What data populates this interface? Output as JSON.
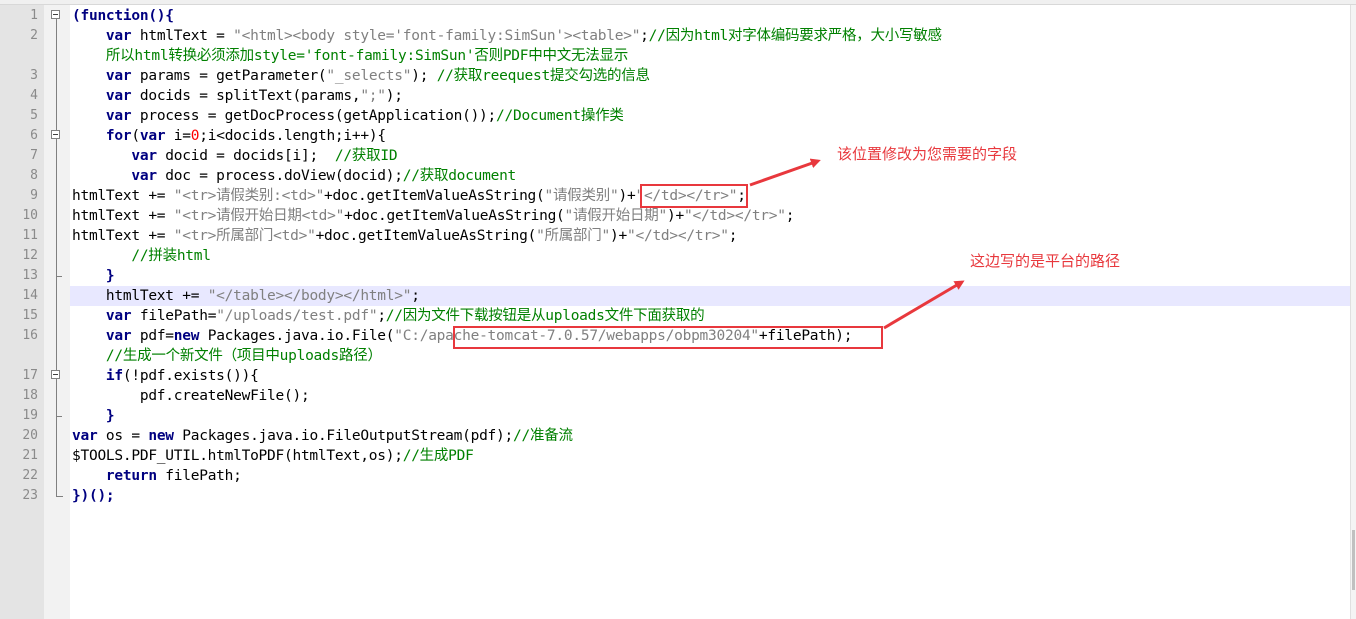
{
  "editor": {
    "lines": [
      {
        "n": "1",
        "fold": "start",
        "tokens": [
          [
            "kw",
            "(function(){"
          ]
        ]
      },
      {
        "n": "2",
        "fold": "body",
        "tokens": [
          [
            "pl",
            "    "
          ],
          [
            "kw",
            "var"
          ],
          [
            "pl",
            " htmlText = "
          ],
          [
            "str",
            "\"<html><body style='font-family:SimSun'><table>\""
          ],
          [
            "pl",
            ";"
          ],
          [
            "cm",
            "//因为html对字体编码要求严格，大小写敏感"
          ]
        ],
        "wrap": [
          [
            "pl",
            "    "
          ],
          [
            "cm",
            "所以html转换必须添加style='font-family:SimSun'否则PDF中中文无法显示"
          ]
        ]
      },
      {
        "n": "3",
        "fold": "body",
        "tokens": [
          [
            "pl",
            "    "
          ],
          [
            "kw",
            "var"
          ],
          [
            "pl",
            " params = getParameter("
          ],
          [
            "str",
            "\"_selects\""
          ],
          [
            "pl",
            "); "
          ],
          [
            "cm",
            "//获取reequest提交勾选的信息"
          ]
        ]
      },
      {
        "n": "4",
        "fold": "body",
        "tokens": [
          [
            "pl",
            "    "
          ],
          [
            "kw",
            "var"
          ],
          [
            "pl",
            " docids = splitText(params,"
          ],
          [
            "str",
            "\";\""
          ],
          [
            "pl",
            ");"
          ]
        ]
      },
      {
        "n": "5",
        "fold": "body",
        "tokens": [
          [
            "pl",
            "    "
          ],
          [
            "kw",
            "var"
          ],
          [
            "pl",
            " process = getDocProcess(getApplication());"
          ],
          [
            "cm",
            "//Document操作类"
          ]
        ]
      },
      {
        "n": "6",
        "fold": "start",
        "tokens": [
          [
            "pl",
            "    "
          ],
          [
            "kw",
            "for"
          ],
          [
            "pl",
            "("
          ],
          [
            "kw",
            "var"
          ],
          [
            "pl",
            " i="
          ],
          [
            "num",
            "0"
          ],
          [
            "pl",
            ";i<docids.length;i++){"
          ]
        ]
      },
      {
        "n": "7",
        "fold": "body",
        "tokens": [
          [
            "pl",
            "       "
          ],
          [
            "kw",
            "var"
          ],
          [
            "pl",
            " docid = docids[i];  "
          ],
          [
            "cm",
            "//获取ID"
          ]
        ]
      },
      {
        "n": "8",
        "fold": "body",
        "tokens": [
          [
            "pl",
            "       "
          ],
          [
            "kw",
            "var"
          ],
          [
            "pl",
            " doc = process.doView(docid);"
          ],
          [
            "cm",
            "//获取document"
          ]
        ]
      },
      {
        "n": "9",
        "fold": "body",
        "tokens": [
          [
            "pl",
            "htmlText += "
          ],
          [
            "str",
            "\"<tr>请假类别:<td>\""
          ],
          [
            "pl",
            "+doc.getItemValueAsString("
          ],
          [
            "str",
            "\"请假类别\""
          ],
          [
            "pl",
            ")+"
          ],
          [
            "str",
            "\"</td></tr>\""
          ],
          [
            "pl",
            ";"
          ]
        ]
      },
      {
        "n": "10",
        "fold": "body",
        "tokens": [
          [
            "pl",
            "htmlText += "
          ],
          [
            "str",
            "\"<tr>请假开始日期<td>\""
          ],
          [
            "pl",
            "+doc.getItemValueAsString("
          ],
          [
            "str",
            "\"请假开始日期\""
          ],
          [
            "pl",
            ")+"
          ],
          [
            "str",
            "\"</td></tr>\""
          ],
          [
            "pl",
            ";"
          ]
        ]
      },
      {
        "n": "11",
        "fold": "body",
        "tokens": [
          [
            "pl",
            "htmlText += "
          ],
          [
            "str",
            "\"<tr>所属部门<td>\""
          ],
          [
            "pl",
            "+doc.getItemValueAsString("
          ],
          [
            "str",
            "\"所属部门\""
          ],
          [
            "pl",
            ")+"
          ],
          [
            "str",
            "\"</td></tr>\""
          ],
          [
            "pl",
            ";"
          ]
        ]
      },
      {
        "n": "12",
        "fold": "body",
        "tokens": [
          [
            "pl",
            "       "
          ],
          [
            "cm",
            "//拼装html"
          ]
        ]
      },
      {
        "n": "13",
        "fold": "end",
        "tokens": [
          [
            "pl",
            "    "
          ],
          [
            "op",
            "}"
          ]
        ]
      },
      {
        "n": "14",
        "fold": "body",
        "current": true,
        "tokens": [
          [
            "pl",
            "    htmlText += "
          ],
          [
            "str",
            "\"</table></body></html>\""
          ],
          [
            "pl",
            ";"
          ]
        ]
      },
      {
        "n": "15",
        "fold": "body",
        "tokens": [
          [
            "pl",
            "    "
          ],
          [
            "kw",
            "var"
          ],
          [
            "pl",
            " filePath="
          ],
          [
            "str",
            "\"/uploads/test.pdf\""
          ],
          [
            "pl",
            ";"
          ],
          [
            "cm",
            "//因为文件下载按钮是从uploads文件下面获取的"
          ]
        ]
      },
      {
        "n": "16",
        "fold": "body",
        "tokens": [
          [
            "pl",
            "    "
          ],
          [
            "kw",
            "var"
          ],
          [
            "pl",
            " pdf="
          ],
          [
            "kw",
            "new"
          ],
          [
            "pl",
            " Packages.java.io.File("
          ],
          [
            "str",
            "\"C:/apache-tomcat-7.0.57/webapps/obpm30204\""
          ],
          [
            "pl",
            "+filePath);"
          ]
        ],
        "wrap": [
          [
            "pl",
            "    "
          ],
          [
            "cm",
            "//生成一个新文件（项目中uploads路径）"
          ]
        ]
      },
      {
        "n": "17",
        "fold": "start",
        "tokens": [
          [
            "pl",
            "    "
          ],
          [
            "kw",
            "if"
          ],
          [
            "pl",
            "(!pdf.exists()){"
          ]
        ]
      },
      {
        "n": "18",
        "fold": "body",
        "tokens": [
          [
            "pl",
            "        pdf.createNewFile();"
          ]
        ]
      },
      {
        "n": "19",
        "fold": "end",
        "tokens": [
          [
            "pl",
            "    "
          ],
          [
            "op",
            "}"
          ]
        ]
      },
      {
        "n": "20",
        "fold": "body",
        "tokens": [
          [
            "kw",
            "var"
          ],
          [
            "pl",
            " os = "
          ],
          [
            "kw",
            "new"
          ],
          [
            "pl",
            " Packages.java.io.FileOutputStream(pdf);"
          ],
          [
            "cm",
            "//准备流"
          ]
        ]
      },
      {
        "n": "21",
        "fold": "body",
        "tokens": [
          [
            "pl",
            "$TOOLS.PDF_UTIL.htmlToPDF(htmlText,os);"
          ],
          [
            "cm",
            "//生成PDF"
          ]
        ]
      },
      {
        "n": "22",
        "fold": "body",
        "tokens": [
          [
            "pl",
            "    "
          ],
          [
            "kw",
            "return"
          ],
          [
            "pl",
            " filePath;"
          ]
        ]
      },
      {
        "n": "23",
        "fold": "last",
        "tokens": [
          [
            "kw",
            "})();"
          ]
        ]
      }
    ]
  },
  "annotations": {
    "field_note": "该位置修改为您需要的字段",
    "path_note": "这边写的是平台的路径",
    "color": "#e8383d"
  }
}
